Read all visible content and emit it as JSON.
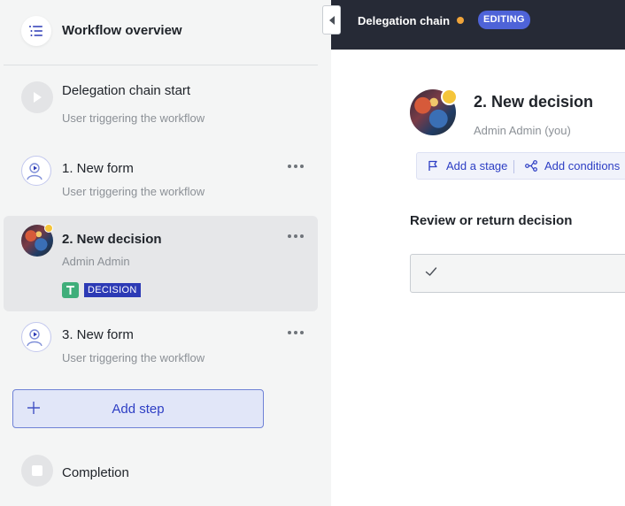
{
  "sidebar": {
    "header": {
      "title": "Workflow overview",
      "icon": "list-icon"
    },
    "start": {
      "title": "Delegation chain start",
      "subtitle": "User triggering the workflow",
      "icon": "play-icon"
    },
    "steps": [
      {
        "title": "1. New form",
        "subtitle": "User triggering the workflow",
        "icon": "user-form-icon"
      },
      {
        "title": "2. New decision",
        "subtitle": "Admin Admin",
        "icon": "avatar",
        "tag": "DECISION",
        "tag_icon": "decision-icon",
        "selected": true
      },
      {
        "title": "3. New form",
        "subtitle": "User triggering the workflow",
        "icon": "user-form-icon"
      }
    ],
    "add_step": {
      "label": "Add step",
      "icon": "plus-icon"
    },
    "completion": {
      "title": "Completion",
      "icon": "stop-icon"
    }
  },
  "topbar": {
    "workflow_name": "Delegation chain",
    "status_badge": "EDITING",
    "status_dot_color": "#f0a43a"
  },
  "main": {
    "step_title": "2. New decision",
    "assignee": "Admin Admin (you)",
    "actions": [
      {
        "label": "Add a stage",
        "icon": "flag-icon"
      },
      {
        "label": "Add conditions",
        "icon": "branch-icon"
      }
    ],
    "section_title": "Review or return decision",
    "review_field": {
      "icon": "check-icon"
    }
  },
  "colors": {
    "accent": "#2d3ec4",
    "badge": "#4e63d8",
    "topbar": "#262a36",
    "sidebar_bg": "#f4f5f5",
    "status_yellow": "#f5c53a",
    "decision_green": "#3fae7a",
    "decision_tag": "#2c3ab5"
  }
}
